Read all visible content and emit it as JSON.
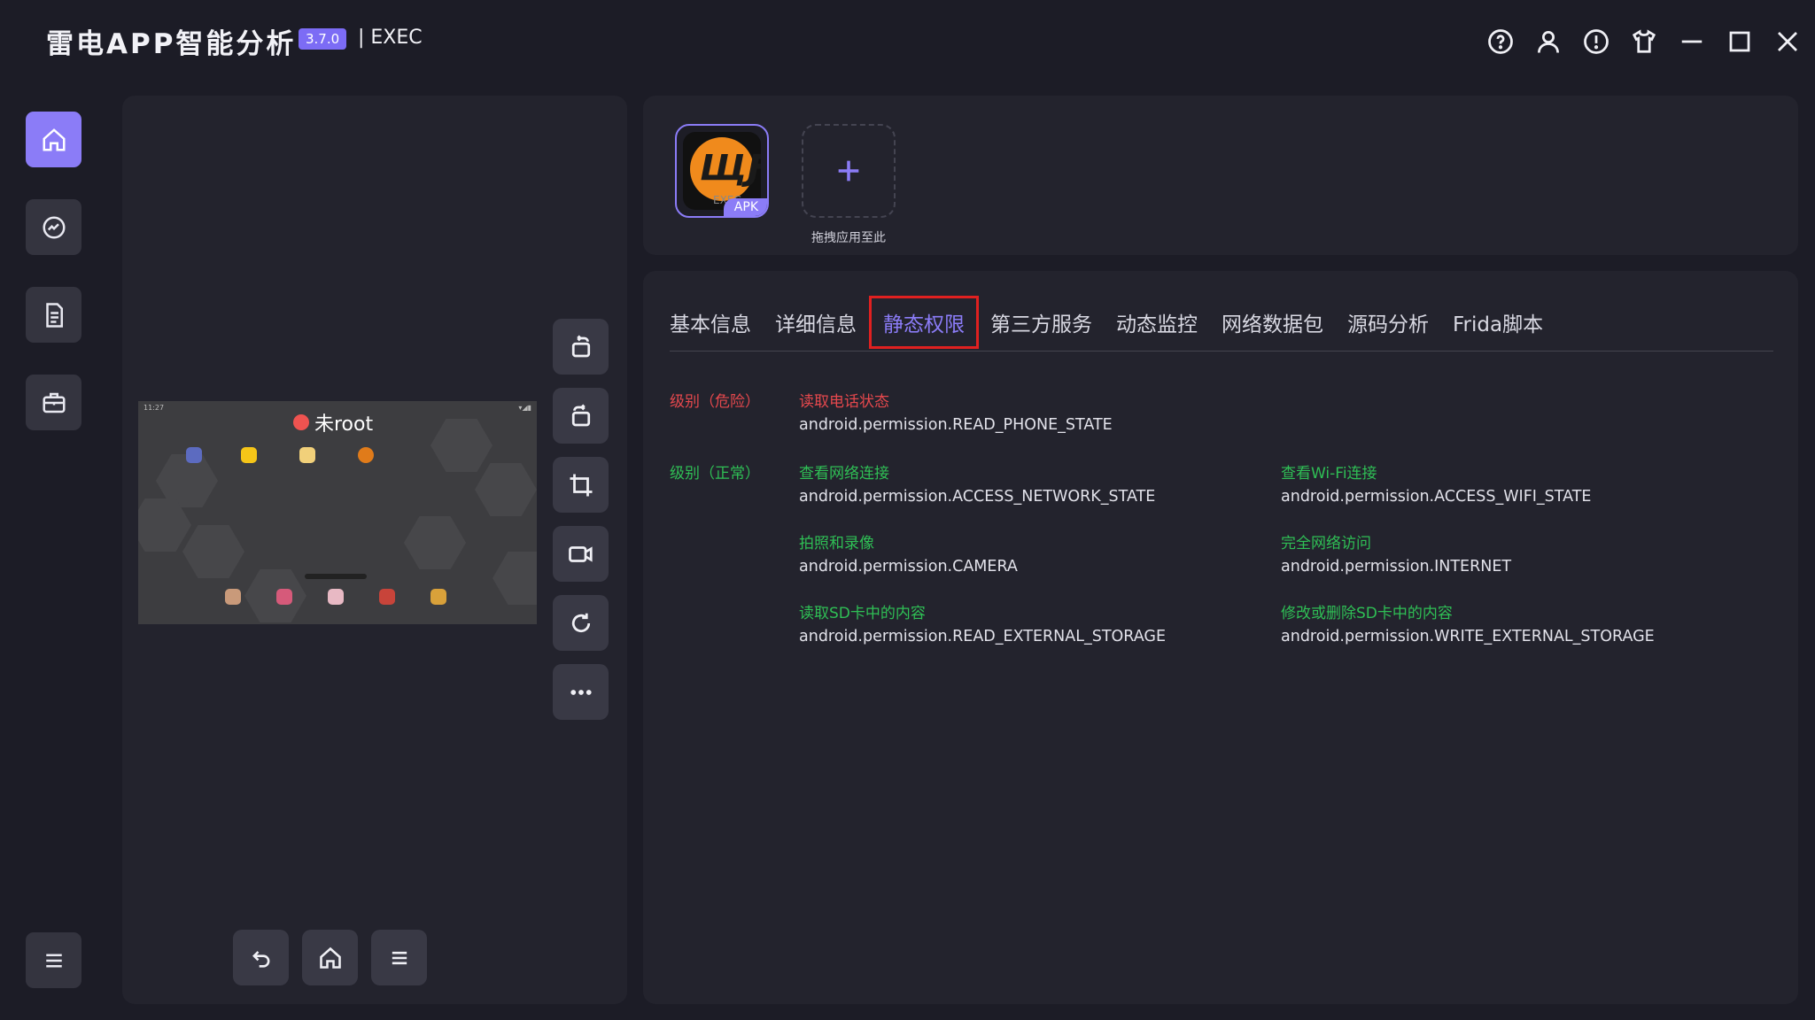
{
  "window": {
    "title": "雷电APP智能分析",
    "version": "3.7.0",
    "suffix": "| EXEC",
    "controls": [
      "help-icon",
      "user-icon",
      "info-icon",
      "shirt-icon",
      "minimize-icon",
      "maximize-icon",
      "close-icon"
    ]
  },
  "sidebar": {
    "items": [
      {
        "icon": "home-icon",
        "active": true
      },
      {
        "icon": "analysis-icon",
        "active": false
      },
      {
        "icon": "document-icon",
        "active": false
      },
      {
        "icon": "toolbox-icon",
        "active": false
      }
    ],
    "bottom_icon": "menu-icon"
  },
  "device": {
    "root_status": "未root",
    "status_time": "11:27",
    "toolbar": [
      "rotate-left-icon",
      "rotate-right-icon",
      "crop-icon",
      "record-icon",
      "refresh-icon",
      "more-icon"
    ],
    "nav": [
      "back-icon",
      "home-icon",
      "menu-icon"
    ]
  },
  "apps": {
    "current": {
      "tag": "APK",
      "sub": "EXEC"
    },
    "add_hint": "拖拽应用至此"
  },
  "tabs": [
    {
      "label": "基本信息",
      "active": false
    },
    {
      "label": "详细信息",
      "active": false
    },
    {
      "label": "静态权限",
      "active": true
    },
    {
      "label": "第三方服务",
      "active": false
    },
    {
      "label": "动态监控",
      "active": false
    },
    {
      "label": "网络数据包",
      "active": false
    },
    {
      "label": "源码分析",
      "active": false
    },
    {
      "label": "Frida脚本",
      "active": false
    }
  ],
  "permissions": {
    "danger": {
      "level_label": "级别（危险）",
      "color": "#e5484d",
      "items": [
        {
          "title": "读取电话状态",
          "id": "android.permission.READ_PHONE_STATE"
        }
      ]
    },
    "normal": {
      "level_label": "级别（正常）",
      "color": "#2fbf55",
      "items": [
        {
          "title": "查看网络连接",
          "id": "android.permission.ACCESS_NETWORK_STATE"
        },
        {
          "title": "查看Wi-Fi连接",
          "id": "android.permission.ACCESS_WIFI_STATE"
        },
        {
          "title": "拍照和录像",
          "id": "android.permission.CAMERA"
        },
        {
          "title": "完全网络访问",
          "id": "android.permission.INTERNET"
        },
        {
          "title": "读取SD卡中的内容",
          "id": "android.permission.READ_EXTERNAL_STORAGE"
        },
        {
          "title": "修改或删除SD卡中的内容",
          "id": "android.permission.WRITE_EXTERNAL_STORAGE"
        }
      ]
    }
  },
  "accent_color": "#8b7cf7"
}
